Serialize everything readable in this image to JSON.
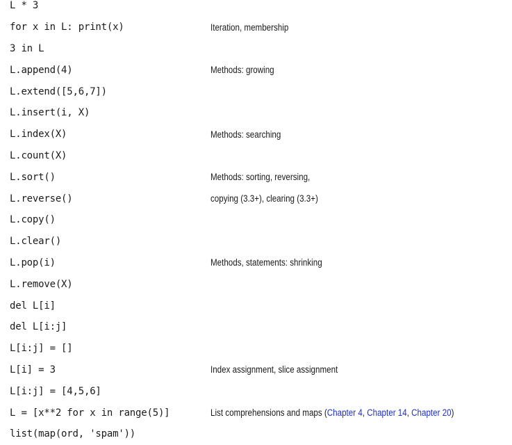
{
  "rows": [
    {
      "code": "L * 3",
      "desc": ""
    },
    {
      "code": "for x in L: print(x)",
      "desc": "Iteration, membership"
    },
    {
      "code": "3 in L",
      "desc": ""
    },
    {
      "code": "L.append(4)",
      "desc": "Methods: growing"
    },
    {
      "code": "L.extend([5,6,7])",
      "desc": ""
    },
    {
      "code": "L.insert(i, X)",
      "desc": ""
    },
    {
      "code": "L.index(X)",
      "desc": "Methods: searching"
    },
    {
      "code": "L.count(X)",
      "desc": ""
    },
    {
      "code": "L.sort()",
      "desc": "Methods: sorting, reversing,"
    },
    {
      "code": "L.reverse()",
      "desc": "copying (3.3+), clearing (3.3+)"
    },
    {
      "code": "L.copy()",
      "desc": ""
    },
    {
      "code": "L.clear()",
      "desc": ""
    },
    {
      "code": "L.pop(i)",
      "desc": "Methods, statements: shrinking"
    },
    {
      "code": "L.remove(X)",
      "desc": ""
    },
    {
      "code": "del L[i]",
      "desc": ""
    },
    {
      "code": "del L[i:j]",
      "desc": ""
    },
    {
      "code": "L[i:j] = []",
      "desc": ""
    },
    {
      "code": "L[i] = 3",
      "desc": "Index assignment, slice assignment"
    },
    {
      "code": "L[i:j] = [4,5,6]",
      "desc": ""
    },
    {
      "code": "L = [x**2 for x in range(5)]",
      "desc": "List comprehensions and maps ("
    },
    {
      "code": "list(map(ord, 'spam'))",
      "desc": ""
    }
  ],
  "refs": {
    "ch4": "Chapter 4",
    "sep1": ", ",
    "ch14": "Chapter 14",
    "sep2": ", ",
    "ch20": "Chapter 20",
    "close": ")"
  },
  "colors": {
    "text": "#1a1a1a",
    "link": "#1d2fc9",
    "background": "#ffffff"
  }
}
